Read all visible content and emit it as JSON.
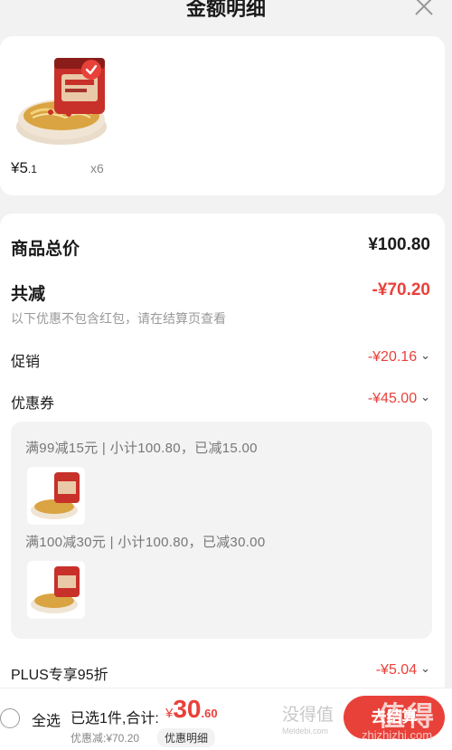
{
  "header": {
    "title": "金额明细"
  },
  "product": {
    "unit_price_main": "¥5",
    "unit_price_decimal": ".1",
    "quantity": "x6"
  },
  "summary": {
    "total_label": "商品总价",
    "total_value": "¥100.80",
    "reduce_label": "共减",
    "reduce_value": "-¥70.20",
    "note": "以下优惠不包含红包，请在结算页查看",
    "promo_label": "促销",
    "promo_value": "-¥20.16",
    "coupon_label": "优惠券",
    "coupon_value": "-¥45.00",
    "plus_label": "PLUS专享95折",
    "plus_value": "-¥5.04"
  },
  "coupons": [
    {
      "text": "满99减15元 | 小计100.80，已减15.00"
    },
    {
      "text": "满100减30元 | 小计100.80，已减30.00"
    }
  ],
  "bottom": {
    "select_all": "全选",
    "selected": "已选1件,合计:",
    "currency": "¥",
    "total_int": "30",
    "total_dec": ".60",
    "discount": "优惠减:¥70.20",
    "detail_tag": "优惠明细",
    "checkout": "去结算",
    "watermark_1": "没得值",
    "watermark_2": "Meldebi.com",
    "watermark_3": "值得",
    "watermark_4": "zhizhizhi.com"
  },
  "colors": {
    "accent": "#e8413a",
    "muted": "#888888",
    "bg": "#f2f2f2"
  },
  "icons": [
    "close-icon",
    "check-icon",
    "chevron-down-icon",
    "radio-icon"
  ]
}
